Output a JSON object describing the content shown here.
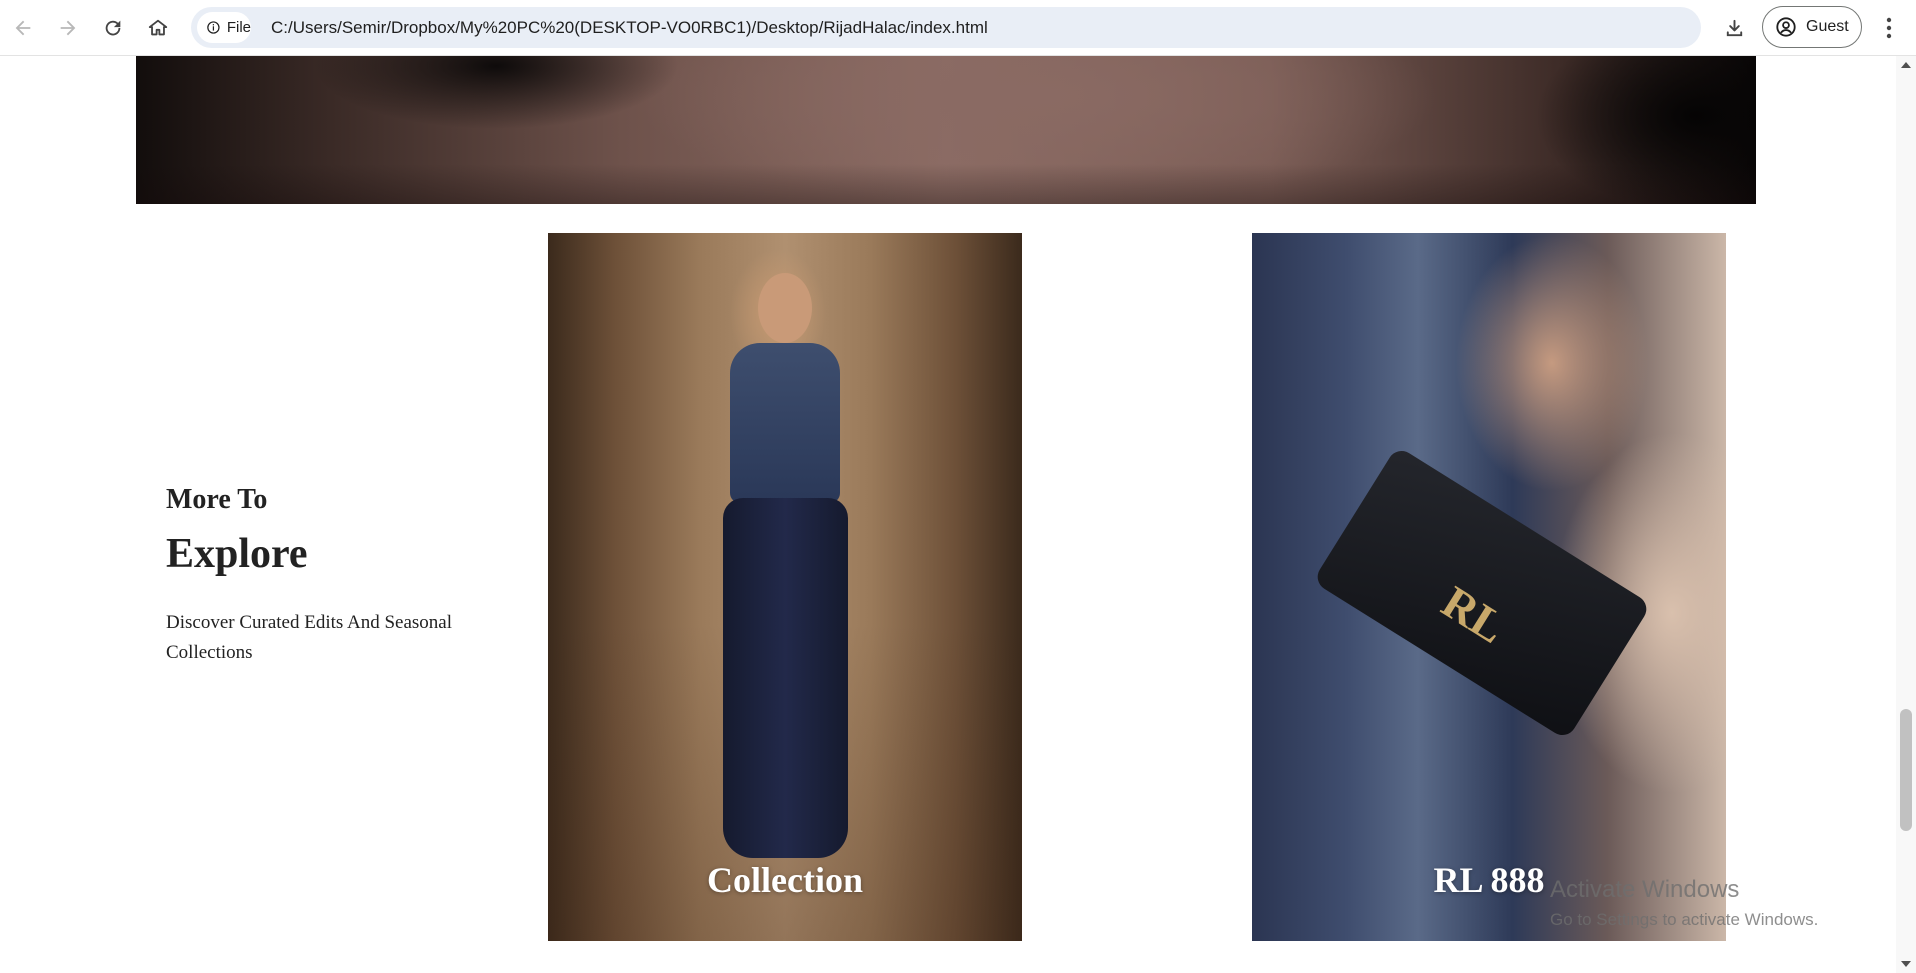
{
  "browser": {
    "chip_label": "File",
    "url": "C:/Users/Semir/Dropbox/My%20PC%20(DESKTOP-VO0RBC1)/Desktop/RijadHalac/index.html",
    "profile_label": "Guest"
  },
  "explore": {
    "kicker": "More To",
    "title": "Explore",
    "description": "Discover Curated Edits And Seasonal Collections"
  },
  "cards": [
    {
      "label": "Collection"
    },
    {
      "label": "RL 888"
    }
  ],
  "watermark": {
    "title": "Activate Windows",
    "subtitle": "Go to Settings to activate Windows."
  },
  "icons": {
    "back": "arrow-left-icon",
    "forward": "arrow-right-icon",
    "reload": "reload-icon",
    "home": "home-icon",
    "site_info": "info-icon",
    "download": "download-icon",
    "profile": "account-circle-icon",
    "menu": "kebab-menu-icon"
  }
}
